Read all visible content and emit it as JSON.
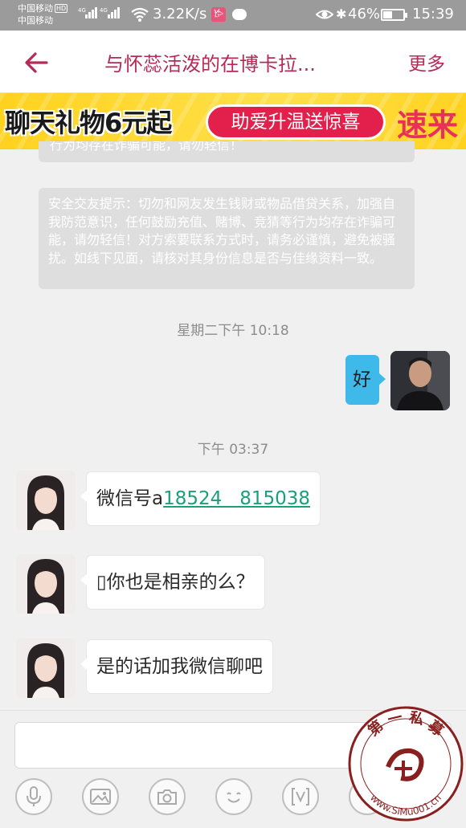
{
  "status_bar": {
    "carrier_1": "中国移动",
    "carrier_2": "中国移动",
    "hd_badge": "HD",
    "network_1": "4G",
    "network_2": "4G",
    "speed": "3.22K/s",
    "app_notification_glyph": "𐂂",
    "battery_percent": "46%",
    "battery_level": 0.46,
    "time": "15:39"
  },
  "header": {
    "back_icon": "arrow-left-icon",
    "title": "与怀蕊活泼的在博卡拉...",
    "more_label": "更多",
    "accent_color": "#b52a56"
  },
  "banner": {
    "main_text": "聊天礼物6元起",
    "pill_text": "助爱升温送惊喜",
    "cta_text": "速来"
  },
  "notices": {
    "partial_text": "行为均存在诈骗可能，请勿轻信！",
    "full_text": "安全交友提示：切勿和网友发生钱财或物品借贷关系，加强自我防范意识，任何鼓励充值、赌博、竞猜等行为均存在诈骗可能，请勿轻信！对方索要联系方式时，请务必谨慎，避免被骚扰。如线下见面，请核对其身份信息是否与佳缘资料一致。"
  },
  "messages": {
    "time_1": "星期二下午 10:18",
    "msg_1": "好",
    "time_2": "下午 03:37",
    "msg_2_prefix": "微信号a",
    "msg_2_link": "18524   815038",
    "msg_3": "▯你也是相亲的么？",
    "msg_4": "是的话加我微信聊吧"
  },
  "input_bar": {
    "input_value": "",
    "tools": [
      "microphone-icon",
      "image-icon",
      "camera-icon",
      "emoji-icon",
      "video-icon",
      "more-icon"
    ]
  },
  "watermark": {
    "top_text": "第 一 私 募",
    "bottom_text": "www.SiMu001.cn"
  },
  "colors": {
    "bubble_sent": "#3fb9e9",
    "bubble_received": "#ffffff",
    "link": "#1aa079",
    "banner_bg": "#ffd21f",
    "banner_pill": "#e3204b"
  }
}
